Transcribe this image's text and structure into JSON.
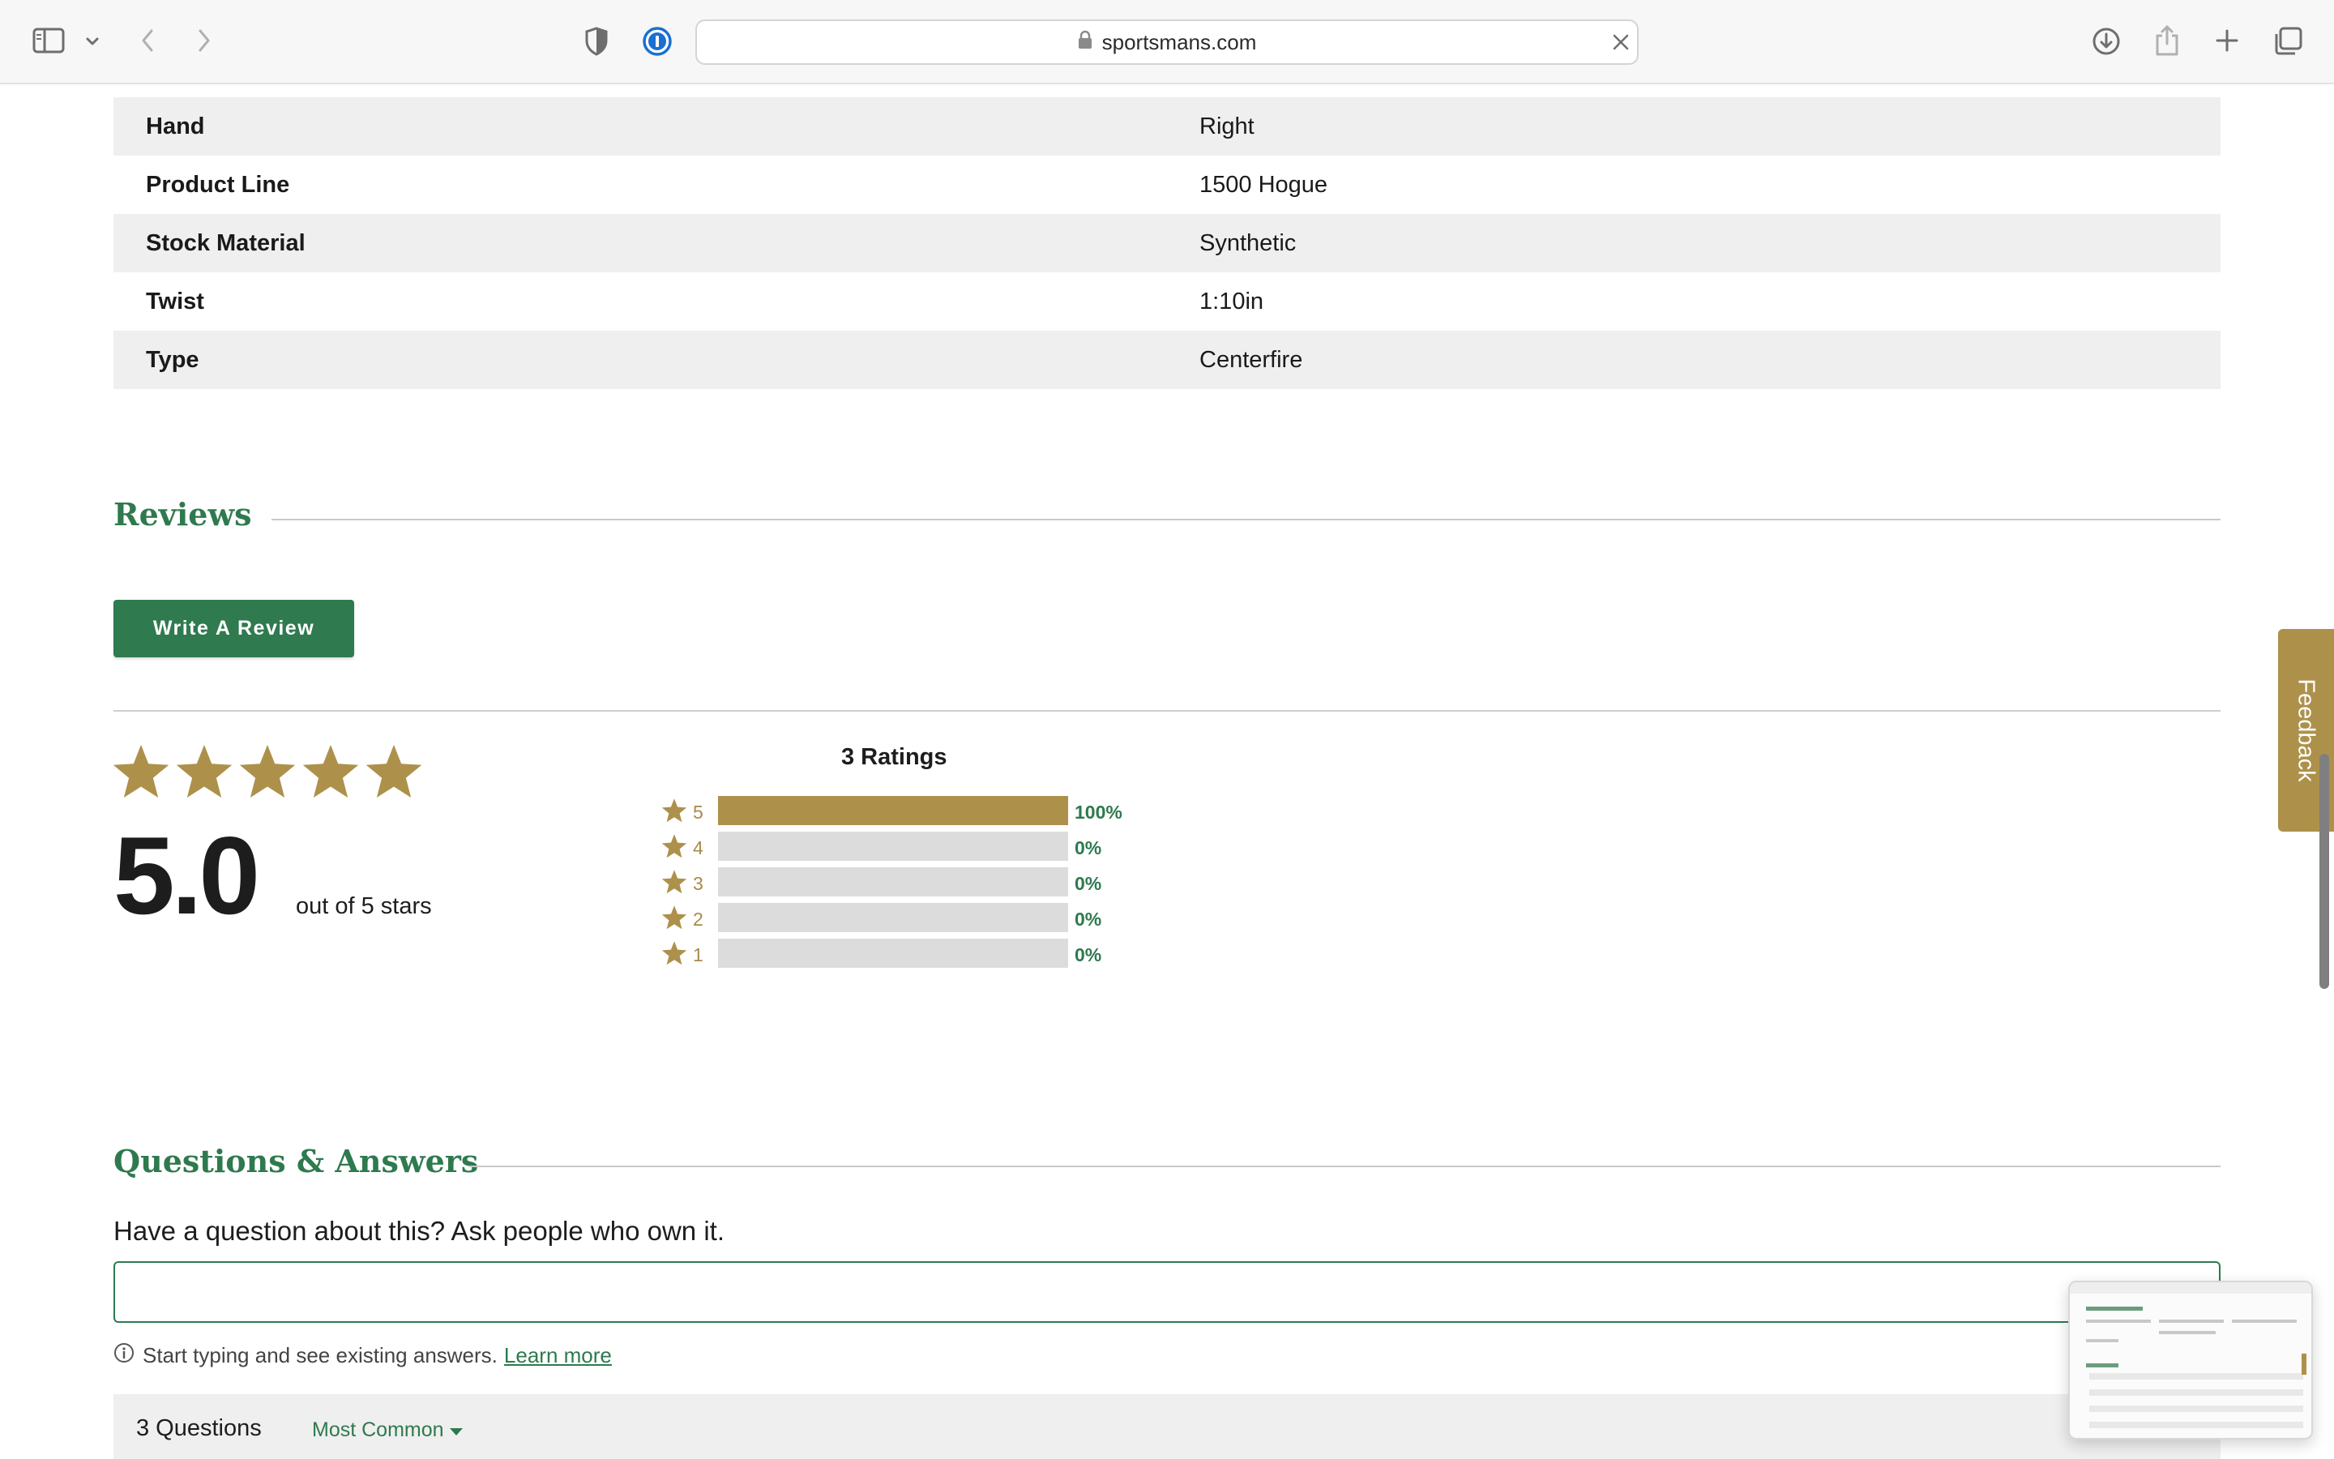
{
  "browser": {
    "url": "sportsmans.com",
    "icons": {
      "sidebar": "sidebar-icon",
      "sidebar_menu": "chevron-down-icon",
      "back": "chevron-left-icon",
      "forward": "chevron-right-icon",
      "privacy": "shield-half-icon",
      "password_manager": "onepassword-icon",
      "lock": "lock-icon",
      "clear": "close-icon",
      "downloads": "download-icon",
      "share": "share-icon",
      "new_tab": "plus-icon",
      "tabs": "tabs-overview-icon"
    }
  },
  "specs": [
    {
      "key": "Hand",
      "value": "Right"
    },
    {
      "key": "Product Line",
      "value": "1500 Hogue"
    },
    {
      "key": "Stock Material",
      "value": "Synthetic"
    },
    {
      "key": "Twist",
      "value": "1:10in"
    },
    {
      "key": "Type",
      "value": "Centerfire"
    }
  ],
  "reviews": {
    "heading": "Reviews",
    "write_button": "Write A Review",
    "average": "5.0",
    "average_stars": 5,
    "out_of": "out of 5 stars",
    "ratings_count": "3 Ratings",
    "histogram": [
      {
        "stars": "5",
        "percent": "100%",
        "fraction": 1.0
      },
      {
        "stars": "4",
        "percent": "0%",
        "fraction": 0
      },
      {
        "stars": "3",
        "percent": "0%",
        "fraction": 0
      },
      {
        "stars": "2",
        "percent": "0%",
        "fraction": 0
      },
      {
        "stars": "1",
        "percent": "0%",
        "fraction": 0
      }
    ]
  },
  "qa": {
    "heading": "Questions & Answers",
    "prompt": "Have a question about this? Ask people who own it.",
    "input_value": "",
    "hint": "Start typing and see existing answers.",
    "learn_more": "Learn more",
    "count": "3 Questions",
    "sort_label": "Most Common"
  },
  "feedback_tab": "Feedback",
  "colors": {
    "brand_green": "#2e7a4e",
    "gold": "#ad914b",
    "row_shade": "#efefef"
  }
}
